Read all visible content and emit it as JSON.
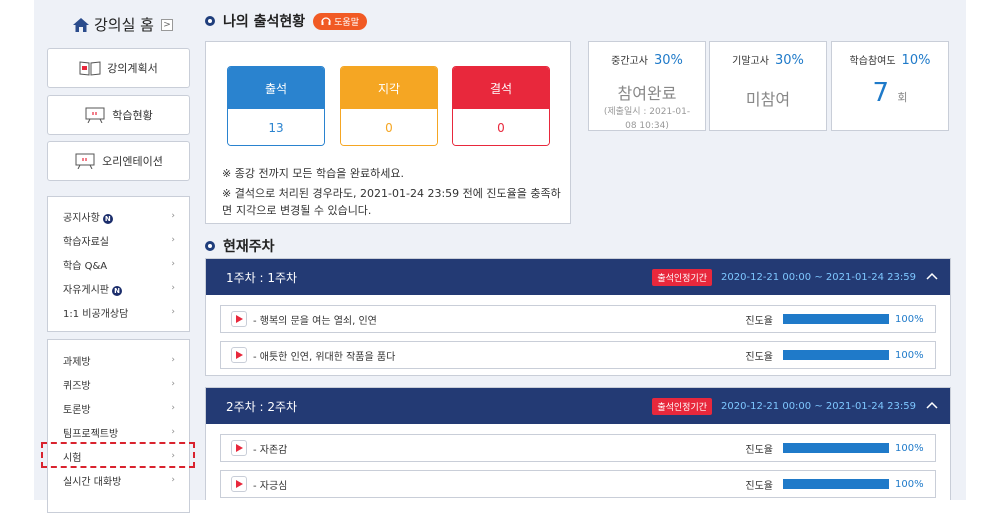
{
  "sidebar": {
    "home_label": "강의실 홈",
    "home_toggle": ">",
    "buttons": [
      {
        "label": "강의계획서",
        "icon": "book-icon"
      },
      {
        "label": "학습현황",
        "icon": "board-icon"
      },
      {
        "label": "오리엔테이션",
        "icon": "board-icon"
      }
    ],
    "menu1": [
      {
        "label": "공지사항",
        "badge": "N"
      },
      {
        "label": "학습자료실",
        "badge": ""
      },
      {
        "label": "학습 Q&A",
        "badge": ""
      },
      {
        "label": "자유게시판",
        "badge": "N"
      },
      {
        "label": "1:1 비공개상담",
        "badge": ""
      }
    ],
    "menu2": [
      {
        "label": "과제방"
      },
      {
        "label": "퀴즈방"
      },
      {
        "label": "토론방"
      },
      {
        "label": "팀프로젝트방"
      },
      {
        "label": "시험"
      },
      {
        "label": "실시간 대화방"
      }
    ],
    "arrow": "›"
  },
  "attendance": {
    "title": "나의 출석현황",
    "help_label": "도움말",
    "cards": [
      {
        "label": "출석",
        "value": "13",
        "color": "#2a83cf"
      },
      {
        "label": "지각",
        "value": "0",
        "color": "#f5a623"
      },
      {
        "label": "결석",
        "value": "0",
        "color": "#e8283c"
      }
    ],
    "notes": [
      "※  종강 전까지 모든 학습을 완료하세요.",
      "※  결석으로 처리된 경우라도, 2021-01-24 23:59 전에 진도율을 충족하면",
      "지각으로 변경될 수 있습니다."
    ]
  },
  "scores": {
    "midterm": {
      "label": "중간고사",
      "pct": "30%",
      "status": "참여완료",
      "sub1": "(제출일시 : 2021-01-",
      "sub2": "08 10:34)"
    },
    "final": {
      "label": "기말고사",
      "pct": "30%",
      "status": "미참여"
    },
    "participation": {
      "label": "학습참여도",
      "pct": "10%",
      "value": "7",
      "unit": "회"
    }
  },
  "current_week": {
    "title": "현재주차",
    "weeks": [
      {
        "title": "1주차 : 1주차",
        "badge": "출석인정기간",
        "range": "2020-12-21 00:00 ~ 2021-01-24 23:59",
        "caret": "^",
        "lessons": [
          {
            "title": "- 행복의 문을 여는 열쇠, 인연",
            "progress_label": "진도율",
            "progress": "100%"
          },
          {
            "title": "- 애틋한 인연, 위대한 작품을 품다",
            "progress_label": "진도율",
            "progress": "100%"
          }
        ]
      },
      {
        "title": "2주차 : 2주차",
        "badge": "출석인정기간",
        "range": "2020-12-21 00:00 ~ 2021-01-24 23:59",
        "caret": "^",
        "lessons": [
          {
            "title": "- 자존감",
            "progress_label": "진도율",
            "progress": "100%"
          },
          {
            "title": "- 자긍심",
            "progress_label": "진도율",
            "progress": "100%"
          }
        ]
      }
    ]
  }
}
